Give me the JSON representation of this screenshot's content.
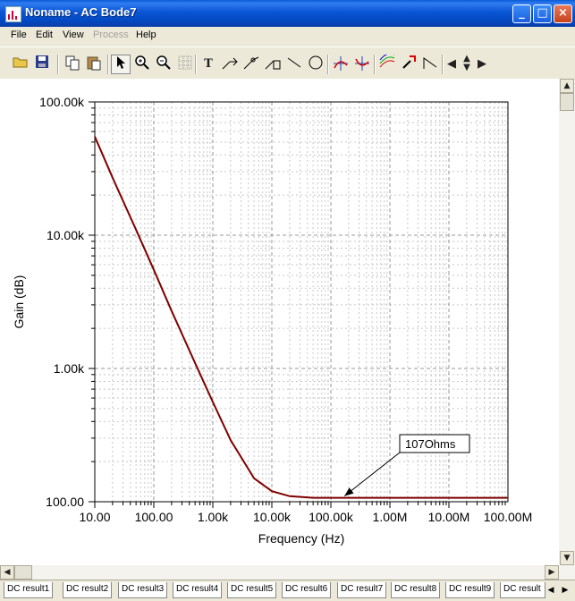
{
  "window": {
    "title": "Noname - AC Bode7"
  },
  "menu": [
    {
      "label": "File",
      "enabled": true
    },
    {
      "label": "Edit",
      "enabled": true
    },
    {
      "label": "View",
      "enabled": true
    },
    {
      "label": "Process",
      "enabled": false
    },
    {
      "label": "Help",
      "enabled": true
    }
  ],
  "toolbar_icons": [
    "open-icon",
    "save-icon",
    "copy-icon",
    "paste-icon",
    "pointer-icon",
    "zoom-in-icon",
    "zoom-out-icon",
    "grid-icon",
    "text-icon",
    "annotate-curve-icon",
    "annotate-point-icon",
    "annotate-axis-icon",
    "line-icon",
    "ellipse-icon",
    "cursor-a-icon",
    "cursor-b-icon",
    "curve-style-icon",
    "marker-icon",
    "step-icon",
    "scroll-left-icon",
    "scroll-up-down-icon",
    "scroll-right-icon"
  ],
  "chart_data": {
    "type": "line",
    "xlabel": "Frequency (Hz)",
    "ylabel": "Gain (dB)",
    "x_scale": "log",
    "y_scale": "log",
    "xlim": [
      10,
      100000000
    ],
    "ylim": [
      100,
      100000
    ],
    "grid": true,
    "x_ticks": [
      "10.00",
      "100.00",
      "1.00k",
      "10.00k",
      "100.00k",
      "1.00M",
      "10.00M",
      "100.00M"
    ],
    "y_ticks": [
      "100.00k",
      "10.00k",
      "1.00k",
      "100.00"
    ],
    "series": [
      {
        "color": "#800000",
        "x": [
          10,
          20,
          50,
          100,
          200,
          500,
          1000,
          2000,
          5000,
          10000,
          20000,
          50000,
          100000,
          1000000,
          10000000,
          100000000
        ],
        "y": [
          55000,
          27000,
          11000,
          5500,
          2700,
          1100,
          560,
          290,
          150,
          120,
          110,
          107,
          107,
          107,
          107,
          107
        ]
      }
    ],
    "annotation": {
      "text": "107Ohms",
      "x": 170000,
      "y": 107
    }
  },
  "tabs": [
    "DC result1",
    "DC result2",
    "DC result3",
    "DC result4",
    "DC result5",
    "DC result6",
    "DC result7",
    "DC result8",
    "DC result9",
    "DC result"
  ]
}
